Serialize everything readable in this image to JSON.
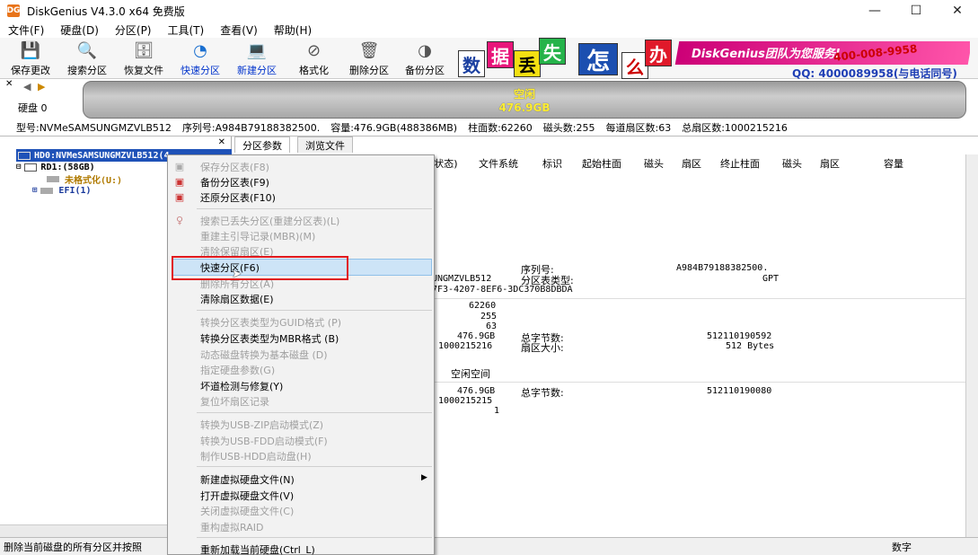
{
  "window": {
    "title": "DiskGenius V4.3.0 x64 免费版",
    "icon": "DG"
  },
  "menubar": [
    "文件(F)",
    "硬盘(D)",
    "分区(P)",
    "工具(T)",
    "查看(V)",
    "帮助(H)"
  ],
  "toolbar": [
    {
      "label": "保存更改",
      "icon": "save-disk-icon",
      "glyph": "💾"
    },
    {
      "label": "搜索分区",
      "icon": "search-icon",
      "glyph": "🔍"
    },
    {
      "label": "恢复文件",
      "icon": "recover-icon",
      "glyph": "🗄"
    },
    {
      "label": "快速分区",
      "icon": "quick-partition-icon",
      "glyph": "◔"
    },
    {
      "label": "新建分区",
      "icon": "new-partition-icon",
      "glyph": "💻"
    },
    {
      "label": "格式化",
      "icon": "format-icon",
      "glyph": "⊘"
    },
    {
      "label": "删除分区",
      "icon": "delete-icon",
      "glyph": "🗑"
    },
    {
      "label": "备份分区",
      "icon": "backup-icon",
      "glyph": "◑"
    }
  ],
  "banner": {
    "tiles": [
      "数",
      "据",
      "丢",
      "失",
      "怎",
      "么",
      "办"
    ],
    "brand": "DiskGenius团队为您服务!",
    "phone": "400-008-9958",
    "qq": "QQ: 4000089958(与电话同号)"
  },
  "diskbar": {
    "disk_label": "硬盘 0",
    "region_name": "空闲",
    "region_size": "476.9GB"
  },
  "infoline": [
    "型号:NVMeSAMSUNGMZVLB512",
    "序列号:A984B79188382500.",
    "容量:476.9GB(488386MB)",
    "柱面数:62260",
    "磁头数:255",
    "每道扇区数:63",
    "总扇区数:1000215216"
  ],
  "tree": [
    "HD0:NVMeSAMSUNGMZVLB512(4",
    "RD1:(58GB)",
    "未格式化(U:)",
    "EFI(1)"
  ],
  "tabs": [
    "分区参数",
    "浏览文件"
  ],
  "columns": [
    "(状态)",
    "文件系统",
    "标识",
    "起始柱面",
    "磁头",
    "扇区",
    "终止柱面",
    "磁头",
    "扇区",
    "容量"
  ],
  "details": {
    "model_partial": "UNGMZVLB512",
    "guid_partial": "7F3-4207-8EF6-3DC370B8DBDA",
    "serial_label": "序列号:",
    "serial_value": "A984B79188382500.",
    "ptype_label": "分区表类型:",
    "ptype_value": "GPT",
    "cylinders": "62260",
    "heads": "255",
    "sectors": "63",
    "capacity": "476.9GB",
    "total_sectors": "1000215216",
    "total_bytes_label": "总字节数:",
    "total_bytes": "512110190592",
    "sector_size_label": "扇区大小:",
    "sector_size": "512 Bytes",
    "free_space_title": "空闲空间",
    "free_capacity": "476.9GB",
    "free_sectors": "1000215215",
    "free_start": "1",
    "free_bytes_label": "总字节数:",
    "free_bytes": "512110190080"
  },
  "context_menu": [
    {
      "label": "保存分区表(F8)",
      "disabled": true,
      "icon": "save-table-icon"
    },
    {
      "label": "备份分区表(F9)",
      "disabled": false,
      "icon": "backup-table-icon"
    },
    {
      "label": "还原分区表(F10)",
      "disabled": false,
      "icon": "restore-table-icon"
    },
    {
      "label": "搜索已丢失分区(重建分区表)(L)",
      "disabled": true,
      "icon": "lost-search-icon"
    },
    {
      "label": "重建主引导记录(MBR)(M)",
      "disabled": true
    },
    {
      "label": "清除保留扇区(E)",
      "disabled": true
    },
    {
      "label": "快速分区(F6)",
      "disabled": false,
      "highlighted": true
    },
    {
      "label": "删除所有分区(A)",
      "disabled": true
    },
    {
      "label": "清除扇区数据(E)",
      "disabled": false
    },
    {
      "label": "转换分区表类型为GUID格式 (P)",
      "disabled": true
    },
    {
      "label": "转换分区表类型为MBR格式 (B)",
      "disabled": false
    },
    {
      "label": "动态磁盘转换为基本磁盘 (D)",
      "disabled": true
    },
    {
      "label": "指定硬盘参数(G)",
      "disabled": true
    },
    {
      "label": "坏道检测与修复(Y)",
      "disabled": false
    },
    {
      "label": "复位坏扇区记录",
      "disabled": true
    },
    {
      "label": "转换为USB-ZIP启动模式(Z)",
      "disabled": true
    },
    {
      "label": "转换为USB-FDD启动模式(F)",
      "disabled": true
    },
    {
      "label": "制作USB-HDD启动盘(H)",
      "disabled": true
    },
    {
      "label": "新建虚拟硬盘文件(N)",
      "disabled": false,
      "submenu": true
    },
    {
      "label": "打开虚拟硬盘文件(V)",
      "disabled": false
    },
    {
      "label": "关闭虚拟硬盘文件(C)",
      "disabled": true
    },
    {
      "label": "重构虚拟RAID",
      "disabled": true
    },
    {
      "label": "重新加载当前硬盘(Ctrl_L)",
      "disabled": false
    }
  ],
  "statusbar": {
    "text": "删除当前磁盘的所有分区并按照",
    "num": "数字"
  },
  "colors": {
    "highlight_box": "#e0191d",
    "menu_hover": "#cde4f7",
    "disabled_text": "#a0a0a0"
  }
}
